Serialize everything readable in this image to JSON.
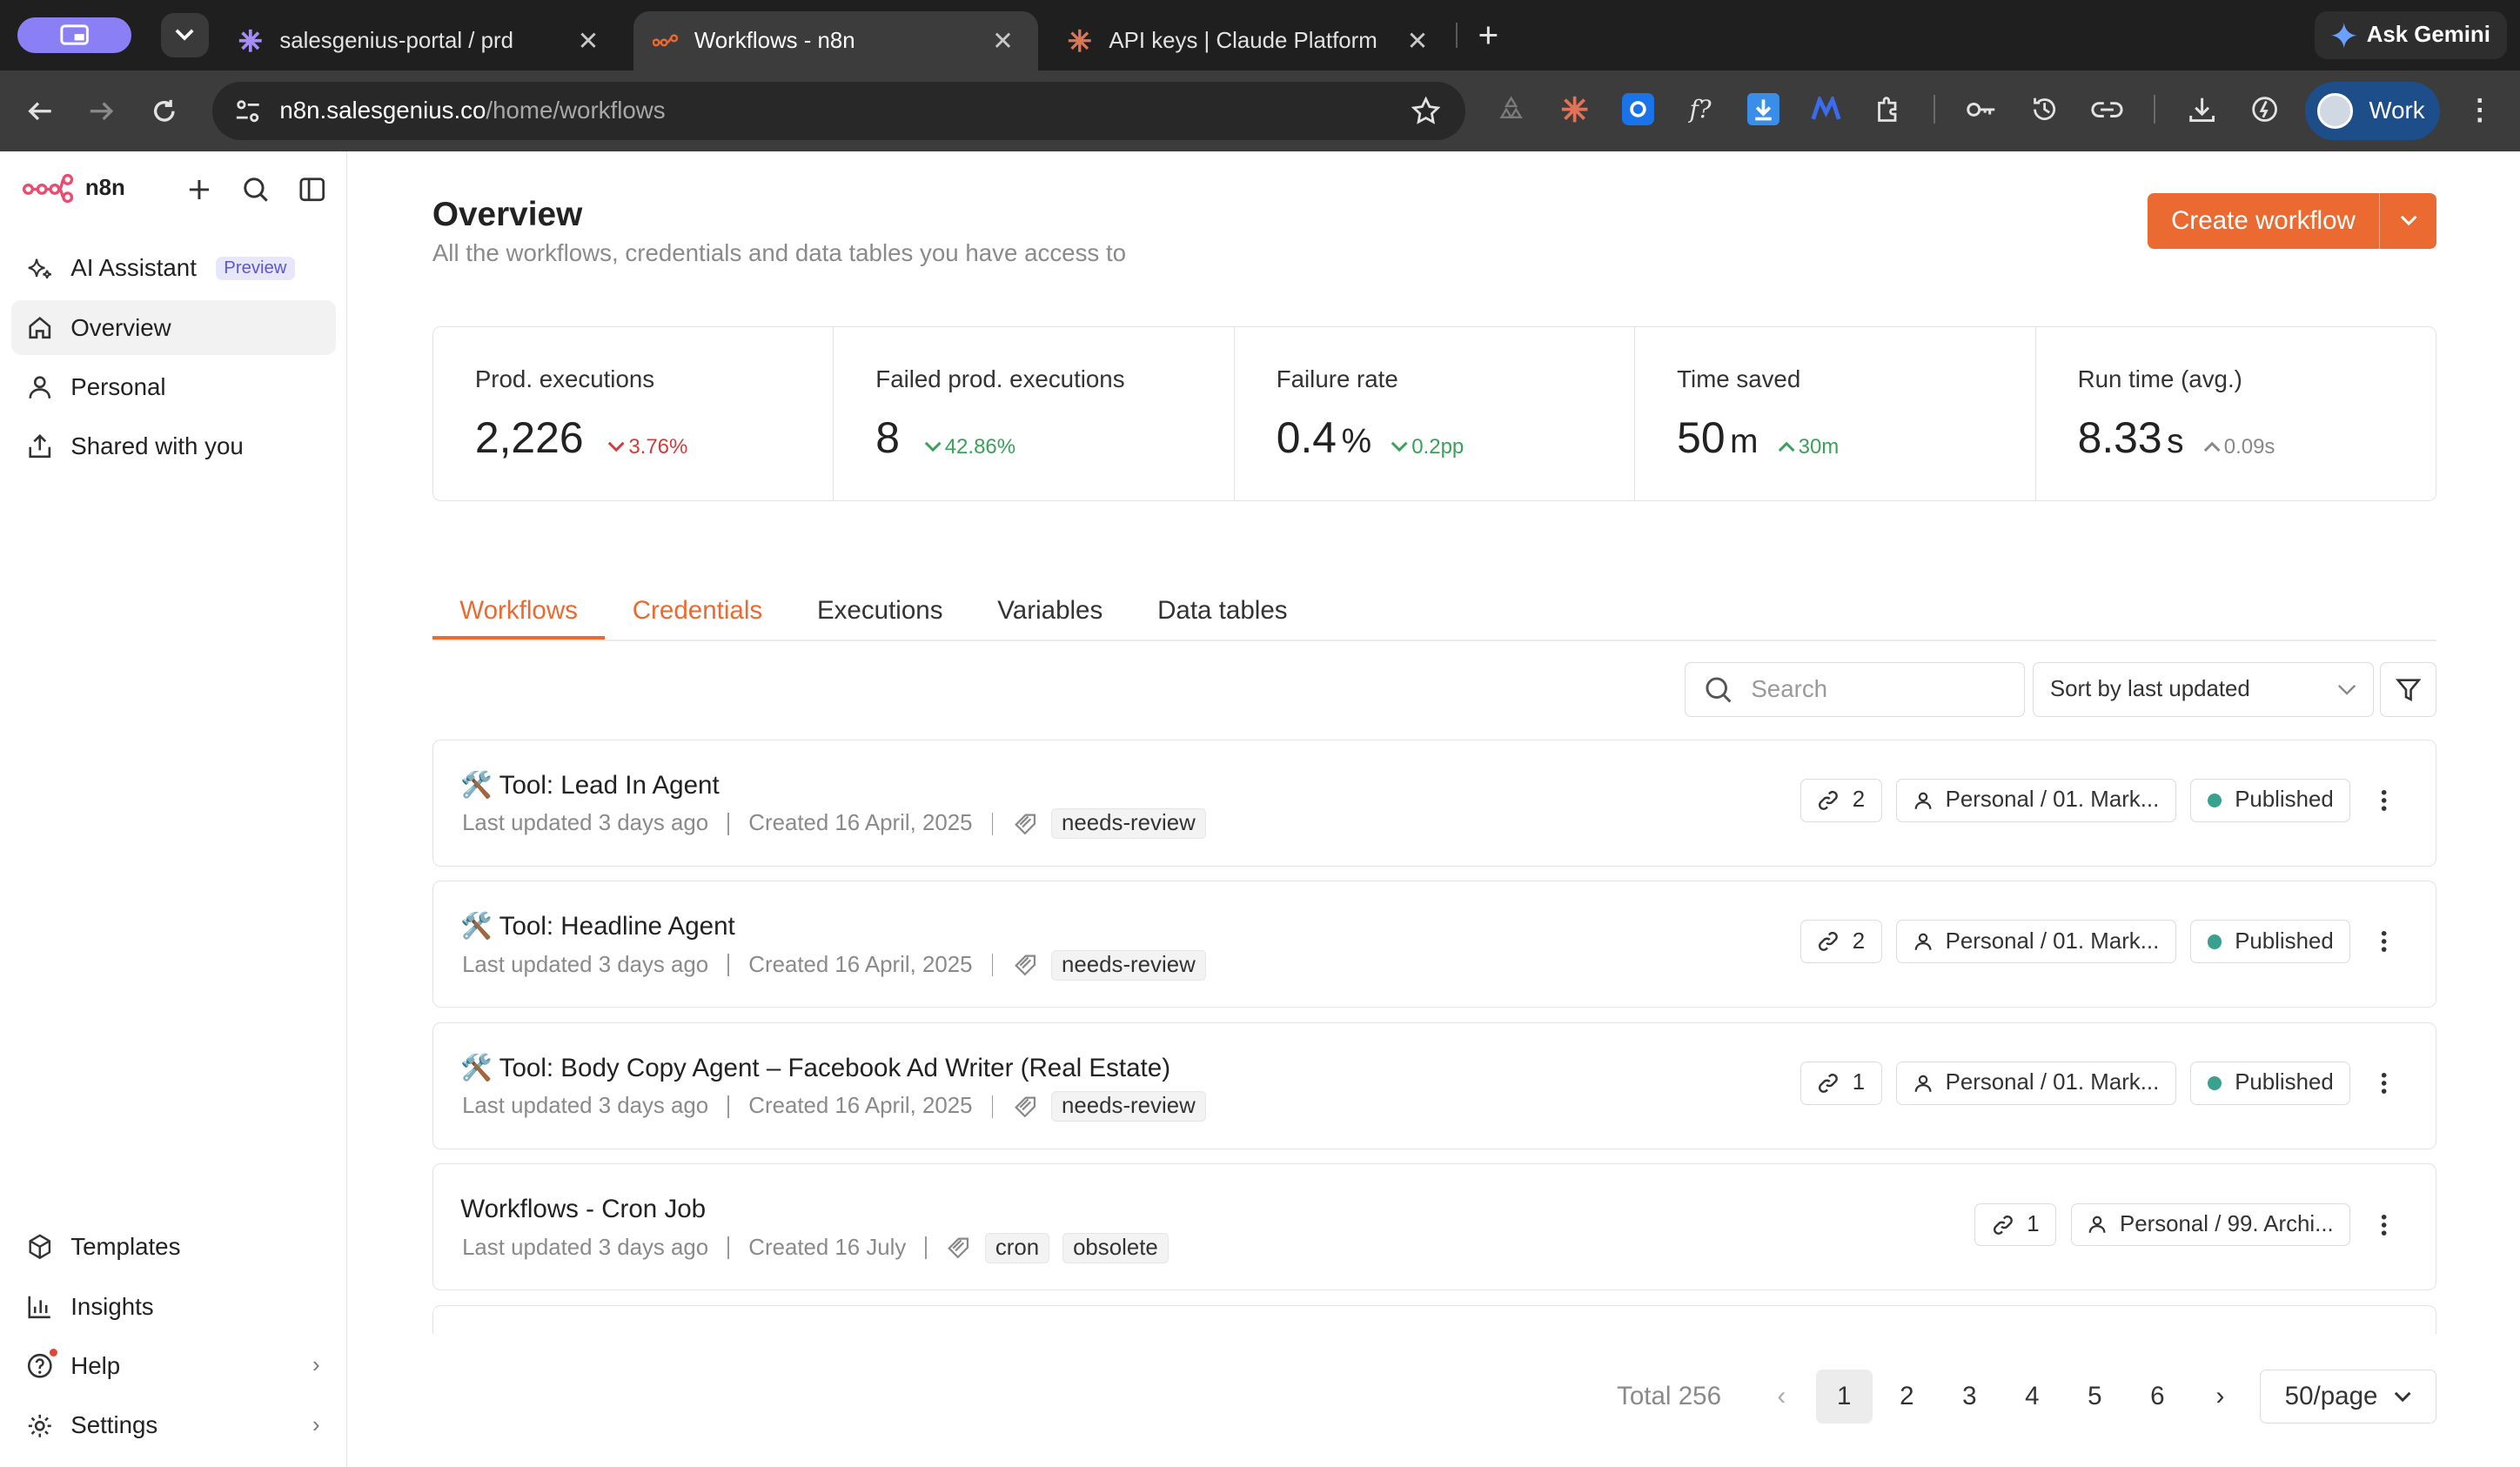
{
  "browser": {
    "tabs": [
      {
        "title": "salesgenius-portal / prd"
      },
      {
        "title": "Workflows - n8n"
      },
      {
        "title": "API keys | Claude Platform"
      }
    ],
    "ask_gemini": "Ask Gemini",
    "url_host": "n8n.salesgenius.co",
    "url_path": "/home/workflows",
    "profile_label": "Work"
  },
  "sidebar": {
    "brand": "n8n",
    "top_items": [
      {
        "label": "AI Assistant",
        "badge": "Preview"
      },
      {
        "label": "Overview"
      },
      {
        "label": "Personal"
      },
      {
        "label": "Shared with you"
      }
    ],
    "bottom_items": [
      {
        "label": "Templates"
      },
      {
        "label": "Insights"
      },
      {
        "label": "Help"
      },
      {
        "label": "Settings"
      }
    ]
  },
  "header": {
    "title": "Overview",
    "subtitle": "All the workflows, credentials and data tables you have access to",
    "create_label": "Create workflow"
  },
  "stats": [
    {
      "title": "Prod. executions",
      "value": "2,226",
      "unit": "",
      "delta": "3.76%",
      "color": "#d33b3b"
    },
    {
      "title": "Failed prod. executions",
      "value": "8",
      "unit": "",
      "delta": "42.86%",
      "color": "#3aa159"
    },
    {
      "title": "Failure rate",
      "value": "0.4",
      "unit": "%",
      "delta": "0.2pp",
      "color": "#3aa159"
    },
    {
      "title": "Time saved",
      "value": "50",
      "unit": "m",
      "delta": "30m",
      "color": "#3aa159"
    },
    {
      "title": "Run time (avg.)",
      "value": "8.33",
      "unit": "s",
      "delta": "0.09s",
      "color": "#888888"
    }
  ],
  "tabs": [
    "Workflows",
    "Credentials",
    "Executions",
    "Variables",
    "Data tables"
  ],
  "controls": {
    "search_placeholder": "Search",
    "sort_label": "Sort by last updated"
  },
  "workflows": [
    {
      "name": "🛠️ Tool: Lead In Agent",
      "updated": "Last updated 3 days ago",
      "created": "Created 16 April, 2025",
      "tags": [
        "needs-review"
      ],
      "links": "2",
      "project": "Personal / 01. Mark...",
      "status": "Published"
    },
    {
      "name": "🛠️ Tool: Headline Agent",
      "updated": "Last updated 3 days ago",
      "created": "Created 16 April, 2025",
      "tags": [
        "needs-review"
      ],
      "links": "2",
      "project": "Personal / 01. Mark...",
      "status": "Published"
    },
    {
      "name": "🛠️ Tool: Body Copy Agent – Facebook Ad Writer (Real Estate)",
      "updated": "Last updated 3 days ago",
      "created": "Created 16 April, 2025",
      "tags": [
        "needs-review"
      ],
      "links": "1",
      "project": "Personal / 01. Mark...",
      "status": "Published"
    },
    {
      "name": "Workflows - Cron Job",
      "updated": "Last updated 3 days ago",
      "created": "Created 16 July",
      "tags": [
        "cron",
        "obsolete"
      ],
      "links": "1",
      "project": "Personal / 99. Archi...",
      "status": ""
    }
  ],
  "pagination": {
    "total": "Total 256",
    "pages": [
      "1",
      "2",
      "3",
      "4",
      "5",
      "6"
    ],
    "current": "1",
    "per_page": "50/page"
  },
  "colors": {
    "accent": "#ea6a31",
    "published_dot": "#3aa18f"
  }
}
